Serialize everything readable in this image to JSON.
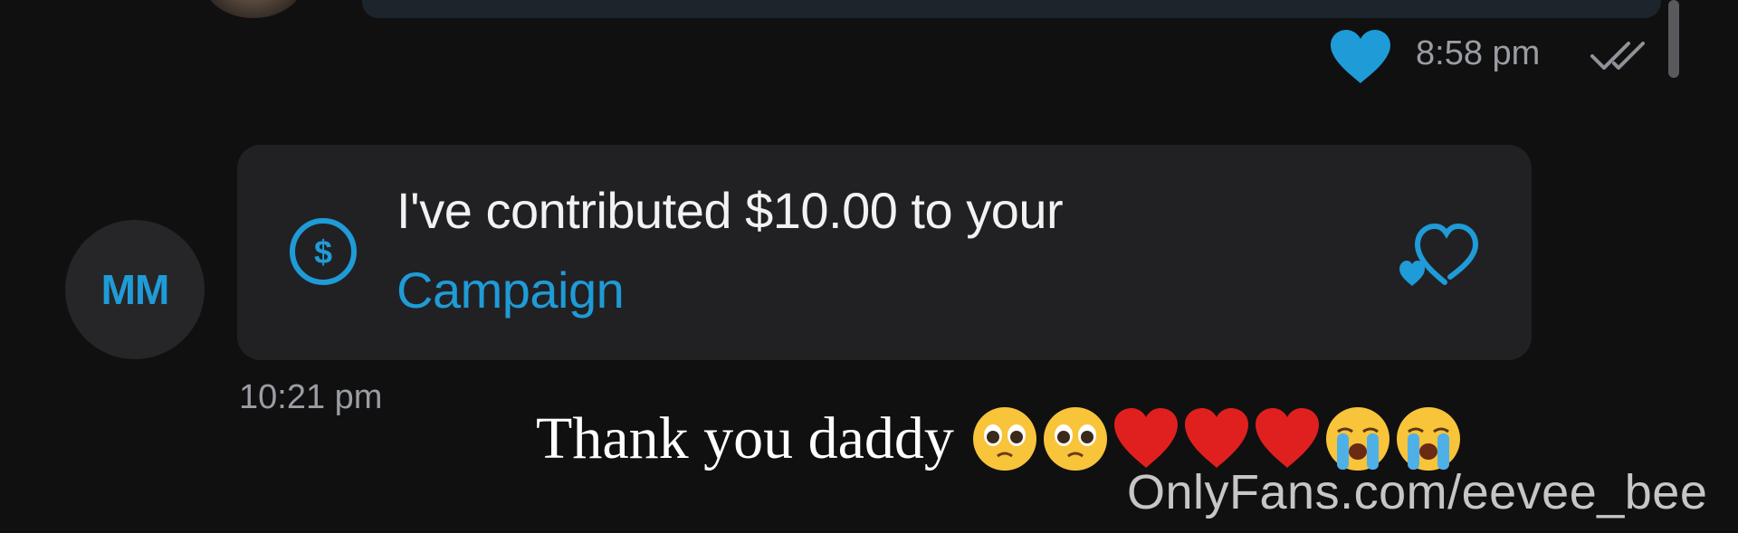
{
  "previous_message": {
    "time": "8:58 pm",
    "liked": true,
    "read_status": "double-check-icon",
    "like_icon": "heart-filled-icon",
    "like_color": "#1f9bd7"
  },
  "incoming": {
    "avatar_initials": "MM",
    "tip_text": "I've contributed $10.00 to your",
    "tip_link": "Campaign",
    "tip_icon": "dollar-circle-icon",
    "action_icon": "heart-outline-icon",
    "time": "10:21 pm"
  },
  "overlay": {
    "caption": "Thank you daddy",
    "emojis": [
      "pleading-face",
      "pleading-face",
      "red-heart",
      "red-heart",
      "red-heart",
      "loudly-crying-face",
      "loudly-crying-face"
    ],
    "watermark": "OnlyFans.com/eevee_bee"
  },
  "colors": {
    "background": "#101011",
    "bubble": "#212124",
    "accent": "#1f9bd7",
    "muted_text": "#9a9da3"
  }
}
